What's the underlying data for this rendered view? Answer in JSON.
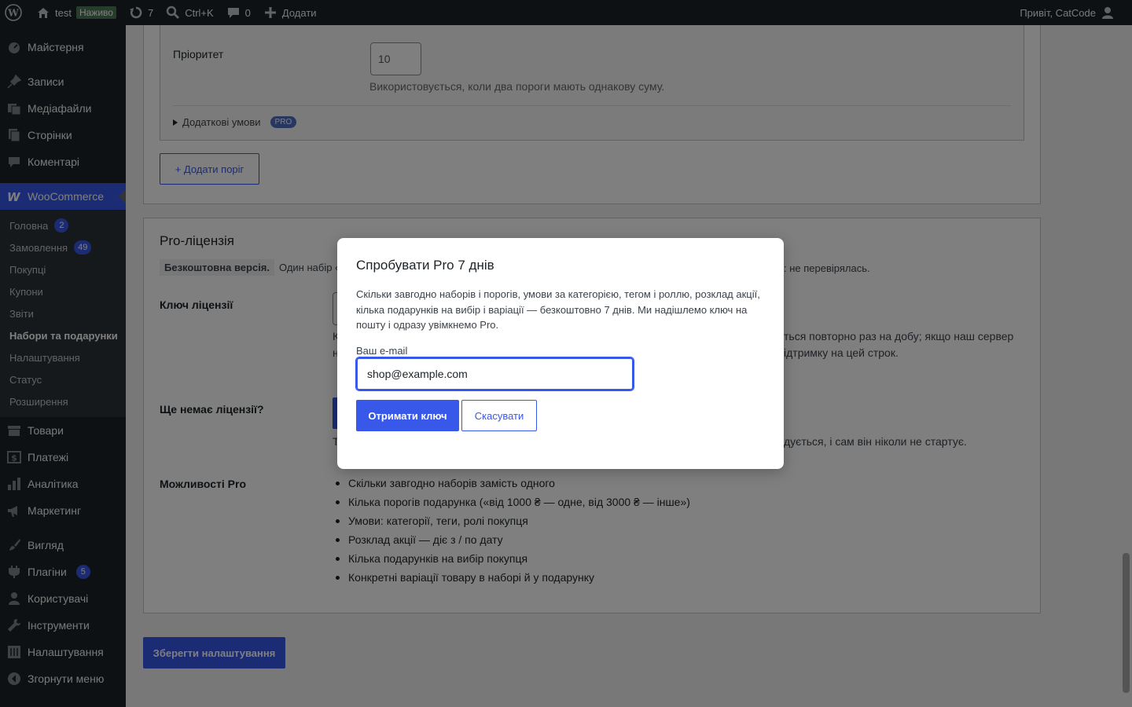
{
  "adminbar": {
    "site_name": "test",
    "live_badge": "Наживо",
    "updates_count": "7",
    "shortcut": "Ctrl+K",
    "comments_count": "0",
    "add_label": "Додати",
    "greeting": "Привіт, CatCode"
  },
  "sidebar": {
    "dashboard": "Майстерня",
    "posts": "Записи",
    "media": "Медіафайли",
    "pages": "Сторінки",
    "comments": "Коментарі",
    "woocommerce": "WooCommerce",
    "sub": {
      "home": "Головна",
      "home_count": "2",
      "orders": "Замовлення",
      "orders_count": "49",
      "customers": "Покупці",
      "coupons": "Купони",
      "reports": "Звіти",
      "bundles": "Набори та подарунки",
      "settings": "Налаштування",
      "status": "Статус",
      "extensions": "Розширення"
    },
    "products": "Товари",
    "payments": "Платежі",
    "analytics": "Аналітика",
    "marketing": "Маркетинг",
    "appearance": "Вигляд",
    "plugins": "Плагіни",
    "plugins_count": "5",
    "users": "Користувачі",
    "tools": "Інструменти",
    "settings": "Налаштування",
    "collapse": "Згорнути меню"
  },
  "threshold": {
    "priority_label": "Пріоритет",
    "priority_value": "10",
    "priority_help": "Використовується, коли два пороги мають однакову суму.",
    "extra_conditions": "Додаткові умови",
    "pro_pill": "PRO",
    "add_threshold": "+ Додати поріг"
  },
  "license": {
    "title": "Pro-ліцензія",
    "free_badge": "Безкоштовна версія.",
    "free_text_left": "Один набір «К",
    "free_text_right": ": не перевірялась.",
    "key_label": "Ключ ліцензії",
    "key_help_line1_left": "К",
    "key_help_line1_right": "ться повторно раз на добу; якщо наш сервер",
    "key_help_line2_left": "н",
    "key_help_line2_right": "ідтримку на цей строк.",
    "no_license_label": "Ще немає ліцензії?",
    "trial_text_left": "Т",
    "trial_text_right": "дується, і сам він ніколи не стартує.",
    "features_label": "Можливості Pro",
    "features": [
      "Скільки завгодно наборів замість одного",
      "Кілька порогів подарунка («від 1000 ₴ — одне, від 3000 ₴ — інше»)",
      "Умови: категорії, теги, ролі покупця",
      "Розклад акції — діє з / по дату",
      "Кілька подарунків на вибір покупця",
      "Конкретні варіації товару в наборі й у подарунку"
    ]
  },
  "save_button": "Зберегти налаштування",
  "modal": {
    "title": "Спробувати Pro 7 днів",
    "text": "Скільки завгодно наборів і порогів, умови за категорією, тегом і роллю, розклад акції, кілька подарунків на вибір і варіації — безкоштовно 7 днів. Ми надішлемо ключ на пошту і одразу увімкнемо Pro.",
    "email_label": "Ваш e-mail",
    "email_value": "shop@example.com",
    "submit": "Отримати ключ",
    "cancel": "Скасувати"
  },
  "colors": {
    "accent": "#3858e9",
    "adminbar": "#1d2327"
  }
}
